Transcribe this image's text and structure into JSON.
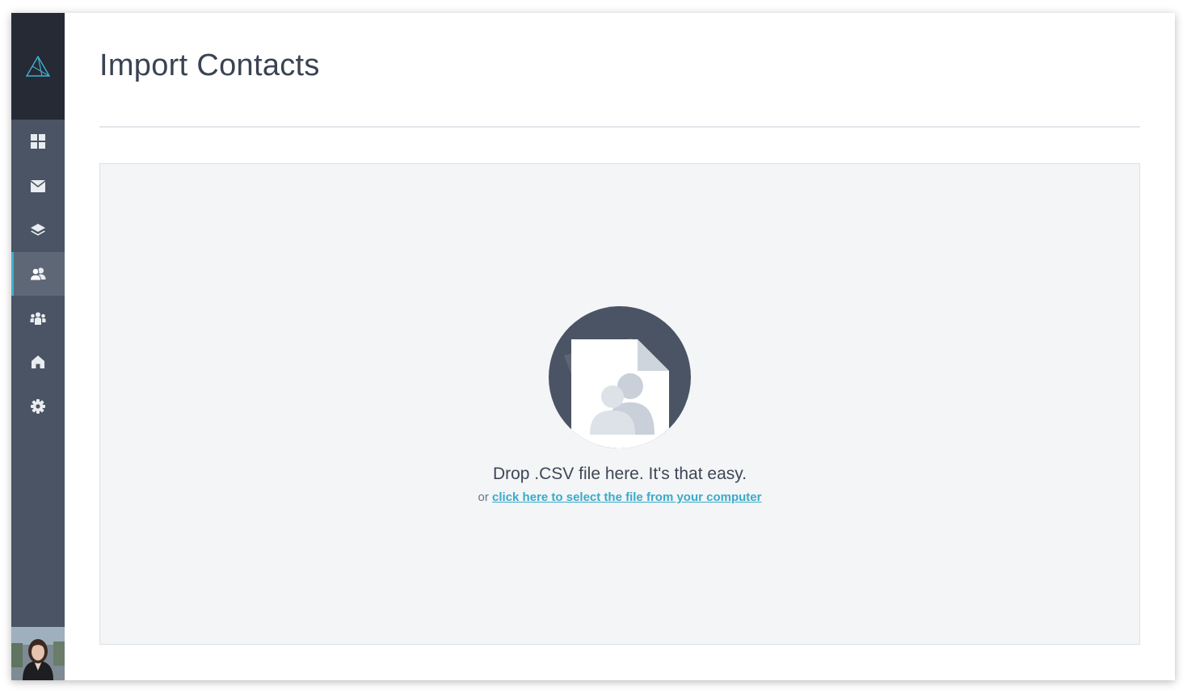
{
  "page": {
    "title": "Import Contacts"
  },
  "sidebar": {
    "items": [
      {
        "id": "dashboard",
        "icon": "grid-icon",
        "active": false
      },
      {
        "id": "mail",
        "icon": "envelope-icon",
        "active": false
      },
      {
        "id": "layers",
        "icon": "layers-icon",
        "active": false
      },
      {
        "id": "contacts",
        "icon": "contacts-icon",
        "active": true
      },
      {
        "id": "groups",
        "icon": "group-icon",
        "active": false
      },
      {
        "id": "home",
        "icon": "home-icon",
        "active": false
      },
      {
        "id": "settings",
        "icon": "gear-icon",
        "active": false
      }
    ],
    "logo_icon": "triangle-logo-icon",
    "avatar_icon": "user-avatar"
  },
  "dropzone": {
    "headline": "Drop .CSV file here. It's that easy.",
    "or_text": "or",
    "select_link": "click here to select the file from your computer",
    "illustration_icon": "csv-contacts-file-icon"
  },
  "colors": {
    "sidebar_bg": "#4a5464",
    "logo_bg": "#252a35",
    "accent": "#3fb1ce",
    "link": "#3aaac9",
    "dropzone_bg": "#f3f5f7",
    "title_text": "#3a4352"
  }
}
